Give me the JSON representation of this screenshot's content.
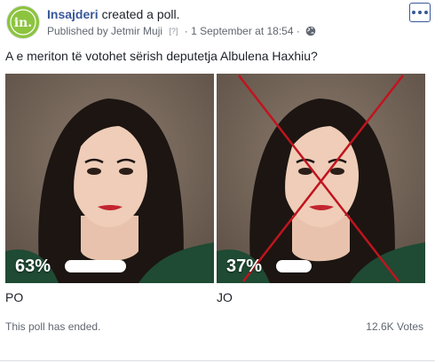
{
  "header": {
    "page_name": "Insajderi",
    "action": "created a poll.",
    "published_by": "Published by Jetmir Muji",
    "help_marker": "[?]",
    "separator": "·",
    "timestamp": "1 September at 18:54",
    "separator2": "·",
    "privacy_icon": "globe-icon",
    "avatar_text": "in."
  },
  "poll": {
    "question": "A e meriton të votohet sërish deputetja Albulena Haxhiu?",
    "options": [
      {
        "label": "PO",
        "percent_text": "63%",
        "percent": 63
      },
      {
        "label": "JO",
        "percent_text": "37%",
        "percent": 37
      }
    ],
    "status": "This poll has ended.",
    "votes": "12.6K Votes"
  },
  "colors": {
    "brand_link": "#385898",
    "avatar_green": "#8cc43f",
    "cross_red": "#c0141e"
  }
}
